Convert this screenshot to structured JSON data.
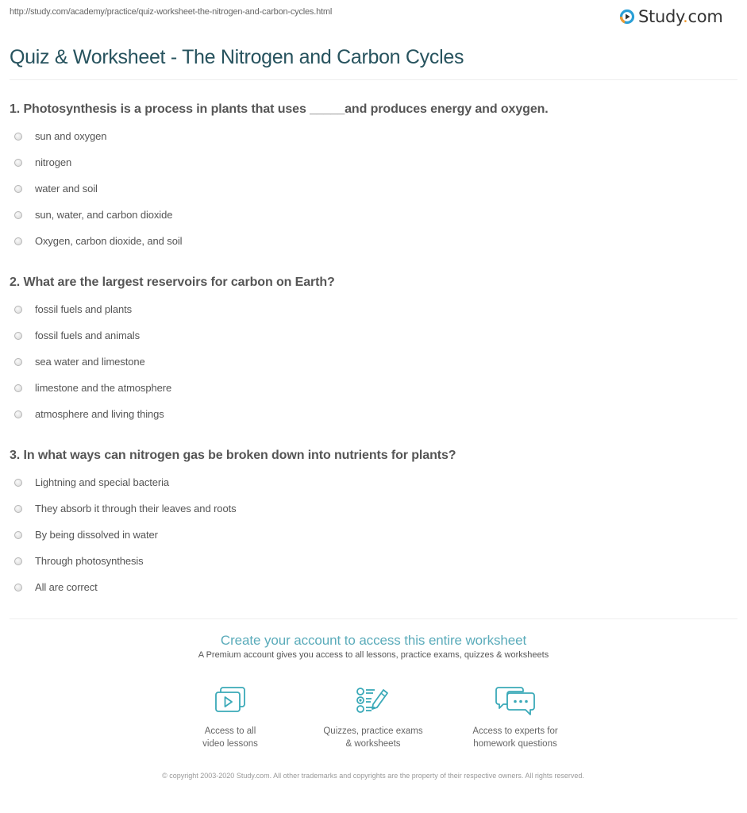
{
  "header": {
    "url": "http://study.com/academy/practice/quiz-worksheet-the-nitrogen-and-carbon-cycles.html",
    "logo": {
      "name_before_dot": "Study",
      "dot": ".",
      "name_after_dot": "com",
      "icon": "play-circle-logo-icon"
    }
  },
  "page": {
    "title": "Quiz & Worksheet - The Nitrogen and Carbon Cycles"
  },
  "questions": [
    {
      "text": "1. Photosynthesis is a process in plants that uses _____and produces energy and oxygen.",
      "options": [
        "sun and oxygen",
        "nitrogen",
        "water and soil",
        "sun, water, and carbon dioxide",
        "Oxygen, carbon dioxide, and soil"
      ]
    },
    {
      "text": "2. What are the largest reservoirs for carbon on Earth?",
      "options": [
        "fossil fuels and plants",
        "fossil fuels and animals",
        "sea water and limestone",
        "limestone and the atmosphere",
        "atmosphere and living things"
      ]
    },
    {
      "text": "3. In what ways can nitrogen gas be broken down into nutrients for plants?",
      "options": [
        "Lightning and special bacteria",
        "They absorb it through their leaves and roots",
        "By being dissolved in water",
        "Through photosynthesis",
        "All are correct"
      ]
    }
  ],
  "cta": {
    "title": "Create your account to access this entire worksheet",
    "subtitle": "A Premium account gives you access to all lessons, practice exams, quizzes & worksheets"
  },
  "features": [
    {
      "icon": "video-lessons-icon",
      "line1": "Access to all",
      "line2": "video lessons"
    },
    {
      "icon": "quiz-checklist-icon",
      "line1": "Quizzes, practice exams",
      "line2": "& worksheets"
    },
    {
      "icon": "chat-bubbles-icon",
      "line1": "Access to experts for",
      "line2": "homework questions"
    }
  ],
  "footer": {
    "copyright": "© copyright 2003-2020 Study.com. All other trademarks and copyrights are the property of their respective owners. All rights reserved."
  },
  "colors": {
    "title": "#27535e",
    "accent_teal": "#5aabba",
    "logo_blue": "#2a9fd6",
    "logo_orange": "#f29a2e",
    "text": "#555555"
  }
}
